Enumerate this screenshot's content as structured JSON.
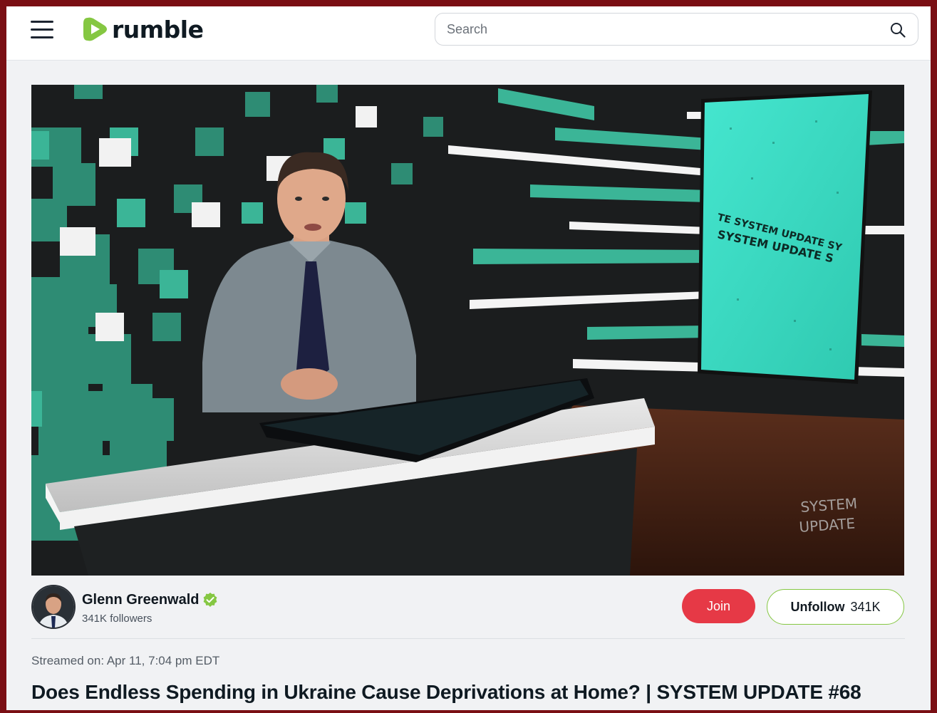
{
  "header": {
    "logo_text": "rumble",
    "search_placeholder": "Search",
    "brand_color": "#85c742"
  },
  "video": {
    "screen_text_line1": "TE SYSTEM UPDATE SY",
    "screen_text_line2": "SYSTEM UPDATE S",
    "watermark_line1": "SYSTEM",
    "watermark_line2": "UPDATE"
  },
  "channel": {
    "name": "Glenn Greenwald",
    "followers": "341K followers",
    "verified": true,
    "join_label": "Join",
    "unfollow_label": "Unfollow",
    "follow_count": "341K"
  },
  "meta": {
    "streamed": "Streamed on: Apr 11, 7:04 pm EDT"
  },
  "title": "Does Endless Spending in Ukraine Cause Deprivations at Home? | SYSTEM UPDATE #68",
  "colors": {
    "join": "#e63946",
    "frame": "#7a0f14",
    "accent_teal": "#3aa58a"
  }
}
